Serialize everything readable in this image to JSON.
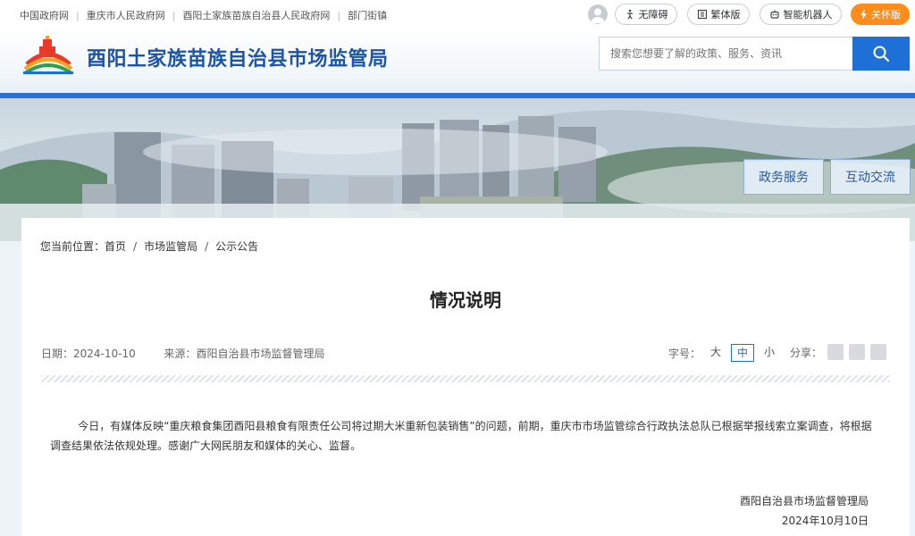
{
  "topbar": {
    "links": [
      "中国政府网",
      "重庆市人民政府网",
      "酉阳土家族苗族自治县人民政府网",
      "部门街镇"
    ],
    "buttons": {
      "accessibility": "无障碍",
      "traditional": "繁体版",
      "robot": "智能机器人",
      "care": "关怀版"
    }
  },
  "header": {
    "title": "酉阳土家族苗族自治县市场监管局",
    "search_placeholder": "搜索您想要了解的政策、服务、资讯"
  },
  "banner": {
    "nav": [
      "政务服务",
      "互动交流"
    ]
  },
  "breadcrumb": {
    "prefix": "您当前位置：",
    "items": [
      "首页",
      "市场监管局",
      "公示公告"
    ]
  },
  "article": {
    "title": "情况说明",
    "date_label": "日期：",
    "date": "2024-10-10",
    "source_label": "来源：",
    "source": "酉阳自治县市场监督管理局",
    "fontsize_label": "字号：",
    "fontsizes": [
      "大",
      "中",
      "小"
    ],
    "share_label": "分享：",
    "body": "今日，有媒体反映“重庆粮食集团酉阳县粮食有限责任公司将过期大米重新包装销售”的问题，前期，重庆市市场监管综合行政执法总队已根据举报线索立案调查，将根据调查结果依法依规处理。感谢广大网民朋友和媒体的关心、监督。",
    "signature": "酉阳自治县市场监督管理局",
    "sign_date": "2024年10月10日"
  },
  "colors": {
    "brand_blue": "#1c54a8",
    "accent_blue": "#1e6fd6",
    "care_orange": "#ff8c1a"
  }
}
